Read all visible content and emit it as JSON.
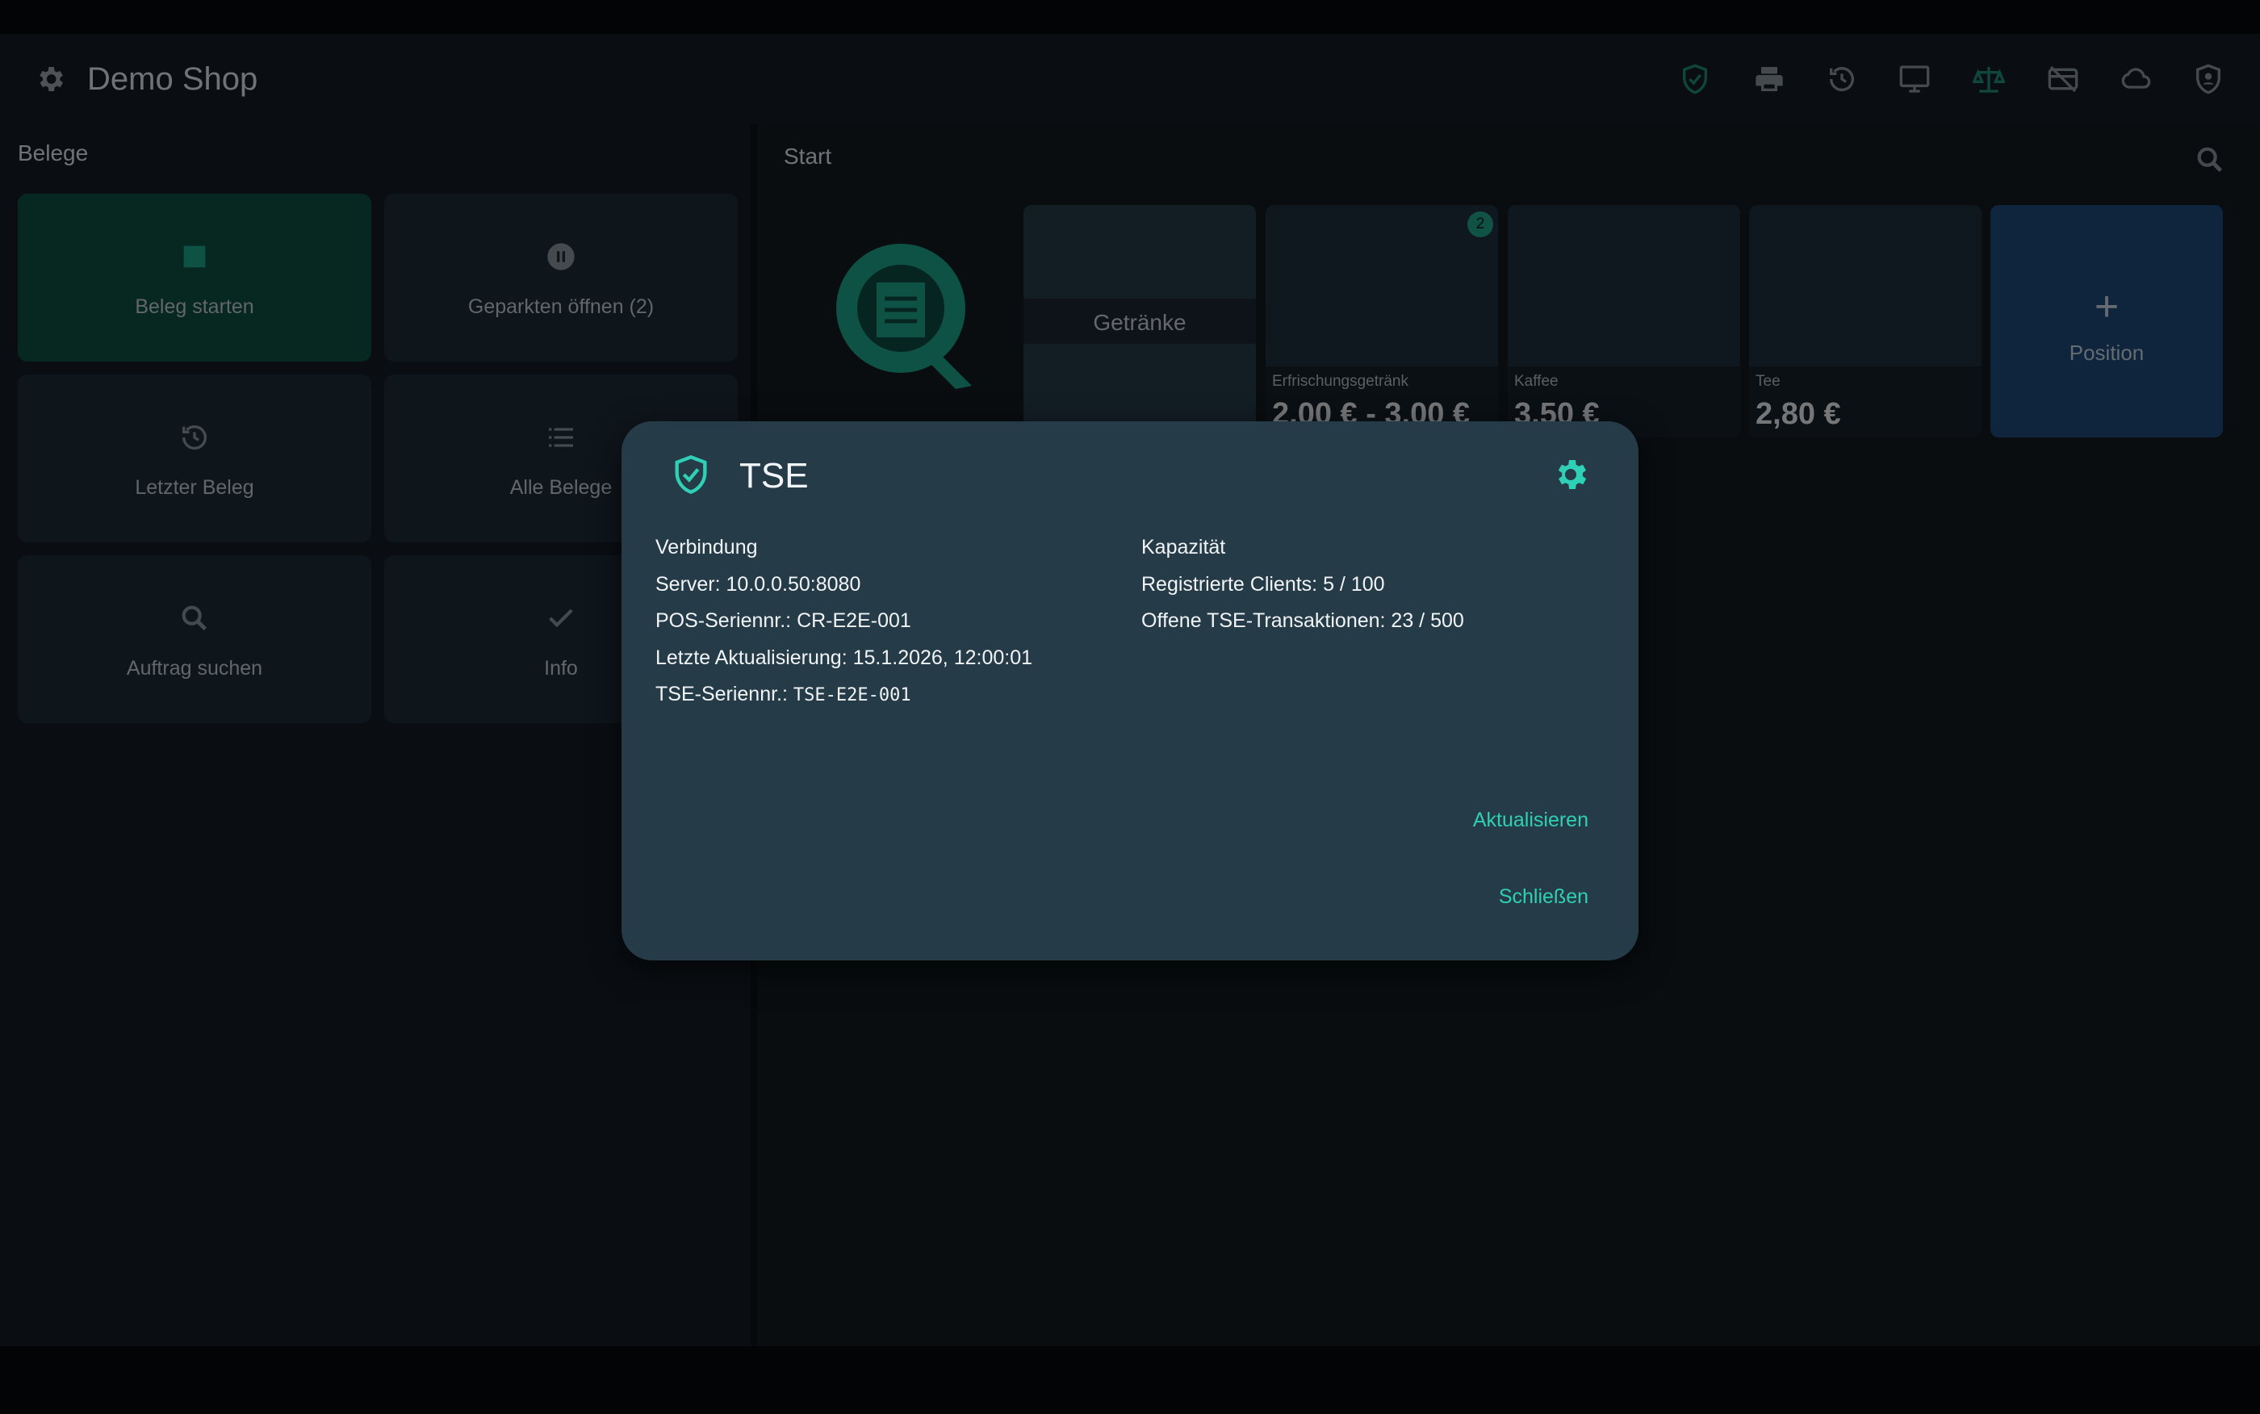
{
  "appbar": {
    "title": "Demo Shop",
    "icons": [
      "shield-check-icon",
      "printer-icon",
      "history-icon",
      "monitor-icon",
      "scale-icon",
      "card-off-icon",
      "cloud-icon",
      "user-shield-icon"
    ]
  },
  "left_panel": {
    "title": "Belege",
    "tiles": [
      {
        "label": "Beleg starten",
        "icon": "stop-icon"
      },
      {
        "label": "Geparkten öffnen (2)",
        "icon": "pause-icon"
      },
      {
        "label": "Letzter Beleg",
        "icon": "history-icon"
      },
      {
        "label": "Alle Belege",
        "icon": "list-icon"
      },
      {
        "label": "Auftrag suchen",
        "icon": "search-icon"
      },
      {
        "label": "Info",
        "icon": "check-icon"
      }
    ]
  },
  "right_panel": {
    "title": "Start",
    "category": "Getränke",
    "products": [
      {
        "name": "Erfrischungsgetränk",
        "price": "2,00 € - 3,00 €",
        "badge": "2"
      },
      {
        "name": "Kaffee",
        "price": "3,50 €"
      },
      {
        "name": "Tee",
        "price": "2,80 €"
      }
    ],
    "add_label": "Position"
  },
  "dialog": {
    "title": "TSE",
    "left": {
      "heading": "Verbindung",
      "server": "Server: 10.0.0.50:8080",
      "pos_serial": "POS-Seriennr.: CR-E2E-001",
      "last_update": "Letzte Aktualisierung: 15.1.2026, 12:00:01",
      "tse_serial_label": "TSE-Seriennr.: ",
      "tse_serial_value": "TSE-E2E-001"
    },
    "right": {
      "heading": "Kapazität",
      "clients": "Registrierte Clients: 5 / 100",
      "transactions": "Offene TSE-Transaktionen: 23 / 500"
    },
    "update_label": "Aktualisieren",
    "close_label": "Schließen"
  },
  "colors": {
    "accent": "#2fd0b5",
    "dialog_bg": "#263b48",
    "tile_bg": "#1d2b37",
    "start_tile": "#0f4f43",
    "add_tile": "#1e4a7a"
  }
}
